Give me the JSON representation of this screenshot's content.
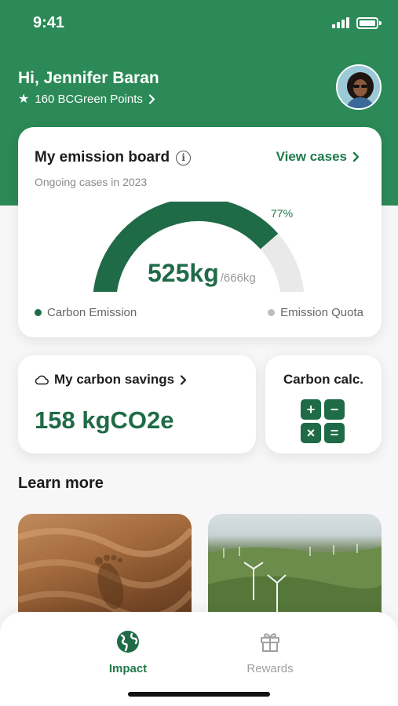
{
  "status_bar": {
    "time": "9:41"
  },
  "header": {
    "greeting": "Hi, Jennifer Baran",
    "points": "160 BCGreen Points"
  },
  "emission_board": {
    "title": "My emission board",
    "view_cases": "View cases",
    "subtitle": "Ongoing cases in 2023",
    "percent": "77%",
    "progress_fraction": 0.77,
    "value": "525kg",
    "quota": "/666kg",
    "legend_emission": "Carbon Emission",
    "legend_quota": "Emission Quota",
    "colors": {
      "emission": "#1f6b47",
      "quota": "#e9e9e9"
    }
  },
  "savings": {
    "title": "My carbon savings",
    "value": "158 kgCO2e"
  },
  "calculator": {
    "title": "Carbon calc.",
    "keys": [
      "+",
      "−",
      "×",
      "="
    ]
  },
  "learn_more": {
    "title": "Learn more",
    "cards": [
      {
        "icon": "footprint-in-sand-image"
      },
      {
        "icon": "wind-turbines-image"
      }
    ]
  },
  "bottom_nav": {
    "items": [
      {
        "label": "Impact",
        "icon": "globe-icon",
        "active": true
      },
      {
        "label": "Rewards",
        "icon": "gift-icon",
        "active": false
      }
    ]
  },
  "colors": {
    "brand_green": "#2b8a57",
    "dark_green": "#1f6b47",
    "accent_green": "#1f7a4c"
  }
}
